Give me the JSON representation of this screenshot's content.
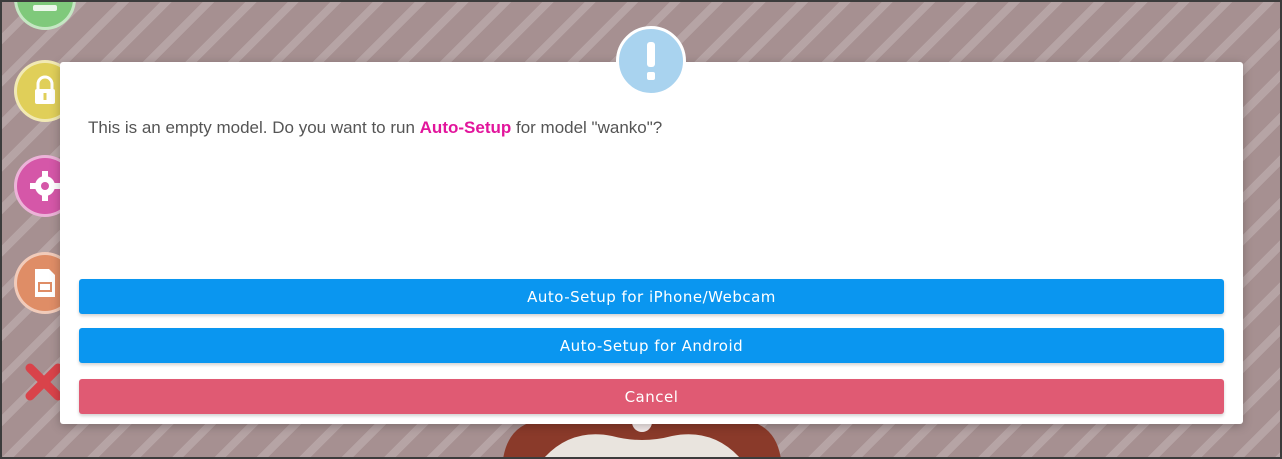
{
  "background": {
    "accent_colors": {
      "green": "#7fc97b",
      "yellow": "#e0cf59",
      "pink": "#d557a8",
      "orange": "#df8d66",
      "red": "#d9434a"
    },
    "sidebar_icons": [
      "sidebar-icon",
      "lock-icon",
      "gear-icon",
      "load-file-icon",
      "close-icon"
    ]
  },
  "dialog": {
    "icon": "exclamation-icon",
    "icon_color": "#a9d3ef",
    "message_before": "This is an empty model. Do you want to run ",
    "message_highlight": "Auto-Setup",
    "message_after": " for model \"wanko\"?",
    "highlight_color": "#e2159c",
    "buttons": {
      "iphone_webcam": "Auto-Setup for iPhone/Webcam",
      "android": "Auto-Setup for Android",
      "cancel": "Cancel"
    },
    "button_colors": {
      "primary": "#0a96f0",
      "cancel": "#e05a73"
    }
  }
}
